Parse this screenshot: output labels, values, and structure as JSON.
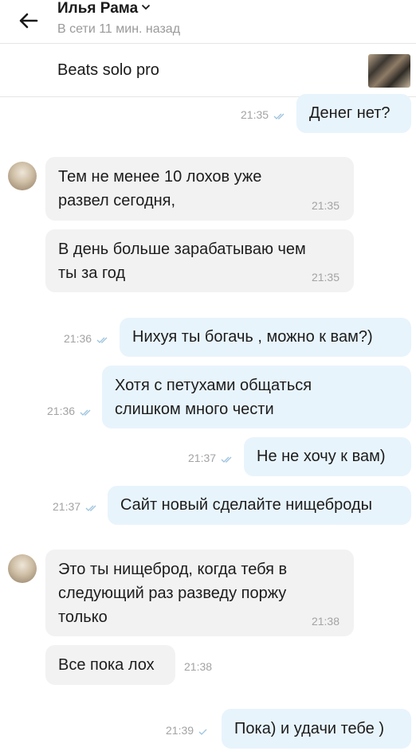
{
  "header": {
    "contact_name": "Илья Рама",
    "status": "В сети 11 мин. назад",
    "icons": {
      "back": "arrow-left-icon",
      "dropdown": "chevron-down-icon"
    }
  },
  "product": {
    "title": "Beats solo pro",
    "thumbnail": "product-thumbnail-image"
  },
  "messages": [
    {
      "direction": "out",
      "lines": [
        "Денег нет?"
      ],
      "time": "21:35",
      "read": true
    },
    {
      "direction": "in",
      "lines": [
        "Тем не менее 10 лохов уже",
        "развел сегодня,"
      ],
      "time": "21:35"
    },
    {
      "direction": "in",
      "lines": [
        "В день больше зарабатываю чем",
        "ты за год"
      ],
      "time": "21:35"
    },
    {
      "direction": "out",
      "lines": [
        "Нихуя ты богачь , можно к вам?)"
      ],
      "time": "21:36",
      "read": true
    },
    {
      "direction": "out",
      "lines": [
        "Хотя с петухами общаться",
        "слишком много чести"
      ],
      "time": "21:36",
      "read": true
    },
    {
      "direction": "out",
      "lines": [
        "Не не хочу к вам)"
      ],
      "time": "21:37",
      "read": true
    },
    {
      "direction": "out",
      "lines": [
        "Сайт новый сделайте нищеброды"
      ],
      "time": "21:37",
      "read": true
    },
    {
      "direction": "in",
      "lines": [
        "Это ты нищеброд, когда тебя в",
        "следующий раз разведу поржу",
        "только"
      ],
      "time": "21:38"
    },
    {
      "direction": "in",
      "lines": [
        "Все пока лох"
      ],
      "time": "21:38"
    },
    {
      "direction": "out",
      "lines": [
        "Пока) и удачи тебе )"
      ],
      "time": "21:39",
      "read": false
    }
  ],
  "colors": {
    "incoming_bubble": "#f2f2f2",
    "outgoing_bubble": "#e8f4fc",
    "timestamp": "#a3a3a3",
    "check": "#9cc3de"
  }
}
